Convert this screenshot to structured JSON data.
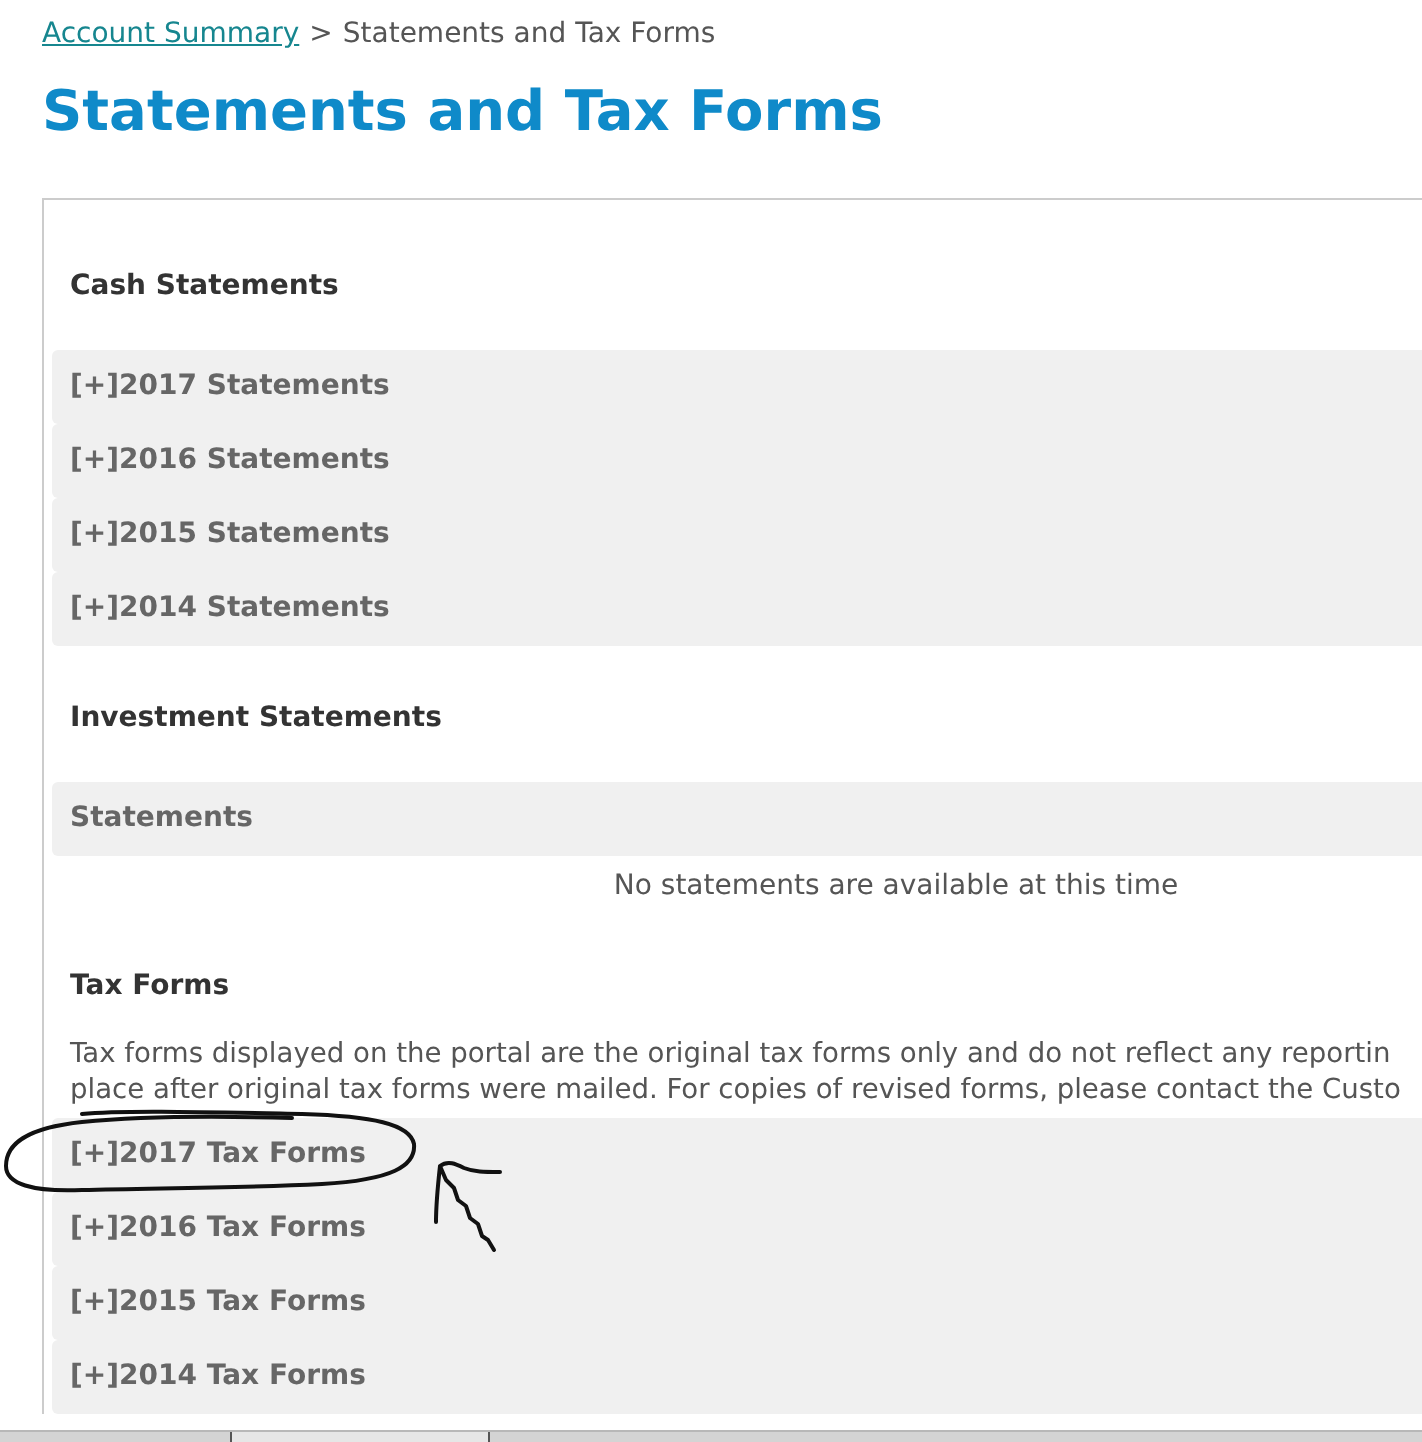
{
  "breadcrumb": {
    "link": "Account Summary",
    "separator": ">",
    "current": "Statements and Tax Forms"
  },
  "title": "Statements and Tax Forms",
  "sections": [
    {
      "kind": "accordion",
      "heading": "Cash Statements",
      "items": [
        {
          "label": "[+]2017 Statements"
        },
        {
          "label": "[+]2016 Statements"
        },
        {
          "label": "[+]2015 Statements"
        },
        {
          "label": "[+]2014 Statements"
        }
      ]
    },
    {
      "kind": "table",
      "heading": "Investment Statements",
      "columns": [
        "Statements"
      ],
      "empty_message": "No statements are available at this time"
    },
    {
      "kind": "accordion",
      "heading": "Tax Forms",
      "note": "Tax forms displayed on the portal are the original tax forms only and do not reflect any reportin\nplace after original tax forms were mailed. For copies of revised forms, please contact the Custo",
      "items": [
        {
          "label": "[+]2017 Tax Forms",
          "circled": true
        },
        {
          "label": "[+]2016 Tax Forms",
          "circled": false
        },
        {
          "label": "[+]2015 Tax Forms",
          "circled": false
        },
        {
          "label": "[+]2014 Tax Forms",
          "circled": false
        }
      ]
    }
  ]
}
